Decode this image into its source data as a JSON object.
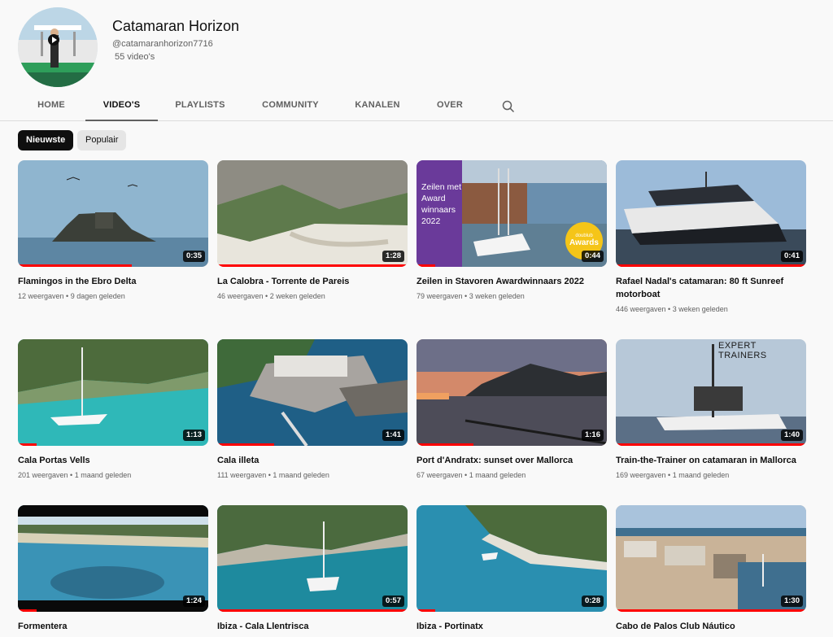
{
  "channel": {
    "name": "Catamaran Horizon",
    "handle": "@catamaranhorizon7716",
    "video_count": "55 video's"
  },
  "tabs": [
    {
      "label": "HOME",
      "active": false
    },
    {
      "label": "VIDEO'S",
      "active": true
    },
    {
      "label": "PLAYLISTS",
      "active": false
    },
    {
      "label": "COMMUNITY",
      "active": false
    },
    {
      "label": "KANALEN",
      "active": false
    },
    {
      "label": "OVER",
      "active": false
    }
  ],
  "chips": [
    {
      "label": "Nieuwste",
      "active": true
    },
    {
      "label": "Populair",
      "active": false
    }
  ],
  "videos": [
    {
      "title": "Flamingos in the Ebro Delta",
      "views": "12 weergaven",
      "age": "9 dagen geleden",
      "duration": "0:35"
    },
    {
      "title": "La Calobra - Torrente de Pareis",
      "views": "46 weergaven",
      "age": "2 weken geleden",
      "duration": "1:28"
    },
    {
      "title": "Zeilen in Stavoren Awardwinnaars 2022",
      "views": "79 weergaven",
      "age": "3 weken geleden",
      "duration": "0:44",
      "overlay_text": "Zeilen met Award winnaars 2022",
      "badge_small": "doublub",
      "badge": "Awards"
    },
    {
      "title": "Rafael Nadal's catamaran: 80 ft Sunreef motorboat",
      "views": "446 weergaven",
      "age": "3 weken geleden",
      "duration": "0:41"
    },
    {
      "title": "Cala Portas Vells",
      "views": "201 weergaven",
      "age": "1 maand geleden",
      "duration": "1:13"
    },
    {
      "title": "Cala illeta",
      "views": "111 weergaven",
      "age": "1 maand geleden",
      "duration": "1:41"
    },
    {
      "title": "Port d'Andratx: sunset over Mallorca",
      "views": "67 weergaven",
      "age": "1 maand geleden",
      "duration": "1:16"
    },
    {
      "title": "Train-the-Trainer on catamaran in Mallorca",
      "views": "169 weergaven",
      "age": "1 maand geleden",
      "duration": "1:40",
      "watermark": "EXPERT TRAINERS"
    },
    {
      "title": "Formentera",
      "views": "",
      "age": "",
      "duration": "1:24"
    },
    {
      "title": "Ibiza - Cala Llentrisca",
      "views": "",
      "age": "",
      "duration": "0:57"
    },
    {
      "title": "Ibiza - Portinatx",
      "views": "",
      "age": "",
      "duration": "0:28"
    },
    {
      "title": "Cabo de Palos Club Náutico",
      "views": "",
      "age": "",
      "duration": "1:30"
    }
  ],
  "progress_fractions": [
    0.6,
    1.0,
    0.1,
    1.0,
    0.1,
    0.3,
    0.3,
    1.0,
    0.1,
    1.0,
    0.1,
    1.0
  ],
  "icons": {
    "search": "search-icon"
  },
  "colors": {
    "accent": "#ff0000",
    "text": "#0f0f0f",
    "secondary": "#606060",
    "background": "#f9f9f9"
  }
}
